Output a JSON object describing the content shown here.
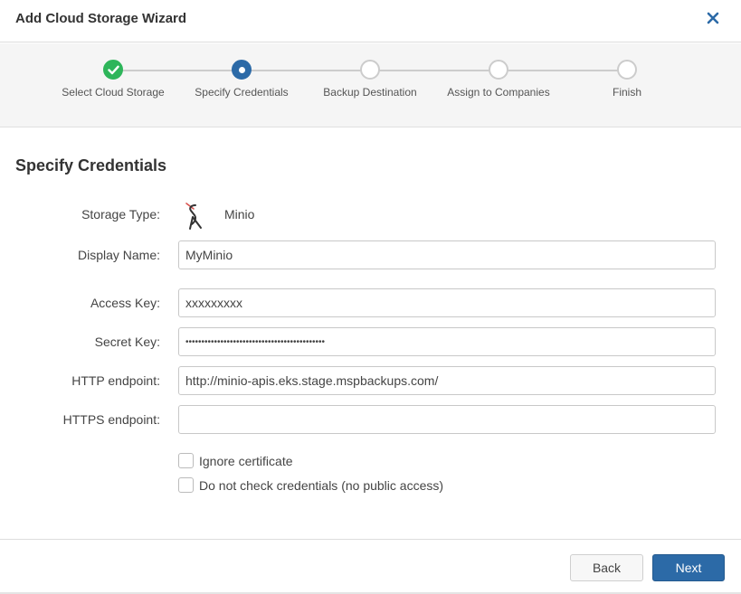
{
  "dialog": {
    "title": "Add Cloud Storage Wizard",
    "close_icon": "close-icon"
  },
  "steps": [
    {
      "label": "Select Cloud Storage",
      "state": "completed"
    },
    {
      "label": "Specify Credentials",
      "state": "current"
    },
    {
      "label": "Backup Destination",
      "state": "pending"
    },
    {
      "label": "Assign to Companies",
      "state": "pending"
    },
    {
      "label": "Finish",
      "state": "pending"
    }
  ],
  "colors": {
    "completed": "#2eb55a",
    "current": "#2c6aa7",
    "pending_border": "#cccccc",
    "primary_button": "#2c6aa7"
  },
  "form": {
    "section_title": "Specify Credentials",
    "storage_type": {
      "label": "Storage Type:",
      "value": "Minio",
      "icon": "minio-logo-icon"
    },
    "display_name": {
      "label": "Display Name:",
      "value": "MyMinio"
    },
    "access_key": {
      "label": "Access Key:",
      "value": "xxxxxxxxx"
    },
    "secret_key": {
      "label": "Secret Key:",
      "value": "••••••••••••••••••••••••••••••••••••••••••••"
    },
    "http_endpoint": {
      "label": "HTTP endpoint:",
      "value": "http://minio-apis.eks.stage.mspbackups.com/"
    },
    "https_endpoint": {
      "label": "HTTPS endpoint:",
      "value": ""
    },
    "ignore_certificate": {
      "label": "Ignore certificate",
      "checked": false
    },
    "skip_check": {
      "label": "Do not check credentials (no public access)",
      "checked": false
    }
  },
  "footer": {
    "back_label": "Back",
    "next_label": "Next"
  }
}
